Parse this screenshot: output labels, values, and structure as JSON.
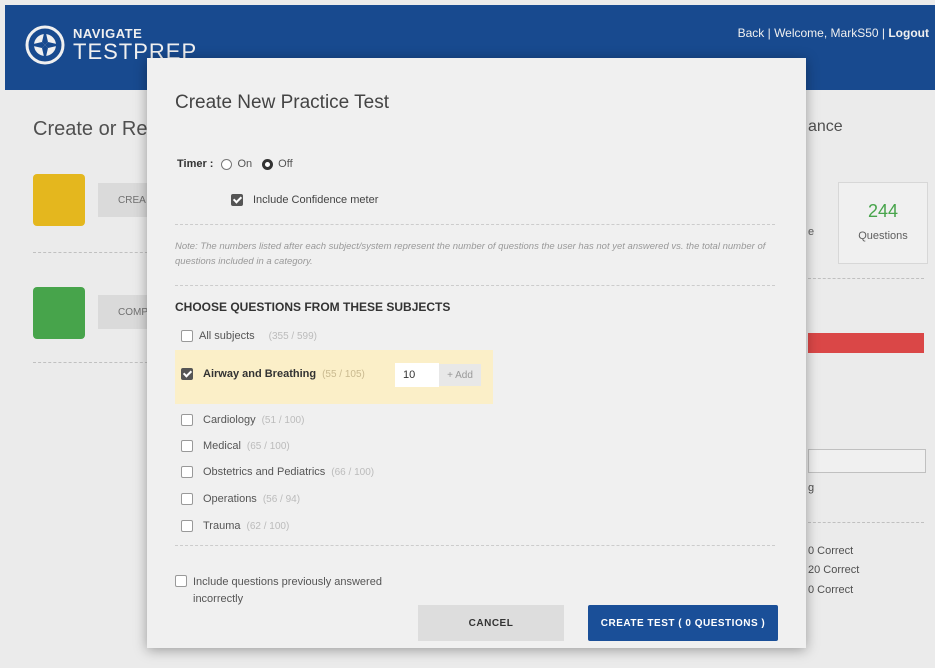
{
  "header": {
    "logo_top": "NAVIGATE",
    "logo_main": "TESTPREP",
    "back": "Back",
    "separator": " | ",
    "welcome": "Welcome, MarkS50",
    "logout": "Logout"
  },
  "background": {
    "title": "Create or Re",
    "right_title": "ance",
    "create_btn": "CREA",
    "comp_btn": "COMP",
    "stat_number": "244",
    "stat_label": "Questions",
    "stat_edge": "e",
    "g_fragment": "g",
    "correct_rows": [
      "0 Correct",
      "20 Correct",
      "0 Correct"
    ]
  },
  "modal": {
    "title": "Create New Practice Test",
    "timer_label": "Timer :",
    "timer_on": "On",
    "timer_off": "Off",
    "timer_selected": "Off",
    "confidence_label": "Include Confidence meter",
    "note": "Note: The numbers listed after each subject/system represent the number of questions the user has not yet answered vs. the total number of questions included in a category.",
    "subjects_heading": "CHOOSE QUESTIONS FROM THESE SUBJECTS",
    "all_subjects": {
      "name": "All subjects",
      "count": "(355 / 599)"
    },
    "selected_subject": {
      "name": "Airway and Breathing",
      "count": "(55 / 105)",
      "quantity": "10",
      "add_label": "+ Add"
    },
    "subjects": [
      {
        "name": "Cardiology",
        "count": "(51 / 100)"
      },
      {
        "name": "Medical",
        "count": "(65 / 100)"
      },
      {
        "name": "Obstetrics and Pediatrics",
        "count": "(66 / 100)"
      },
      {
        "name": "Operations",
        "count": "(56 / 94)"
      },
      {
        "name": "Trauma",
        "count": "(62 / 100)"
      }
    ],
    "previous_label": "Include questions previously answered incorrectly",
    "cancel_label": "CANCEL",
    "create_label": "CREATE TEST (  0  QUESTIONS )"
  }
}
